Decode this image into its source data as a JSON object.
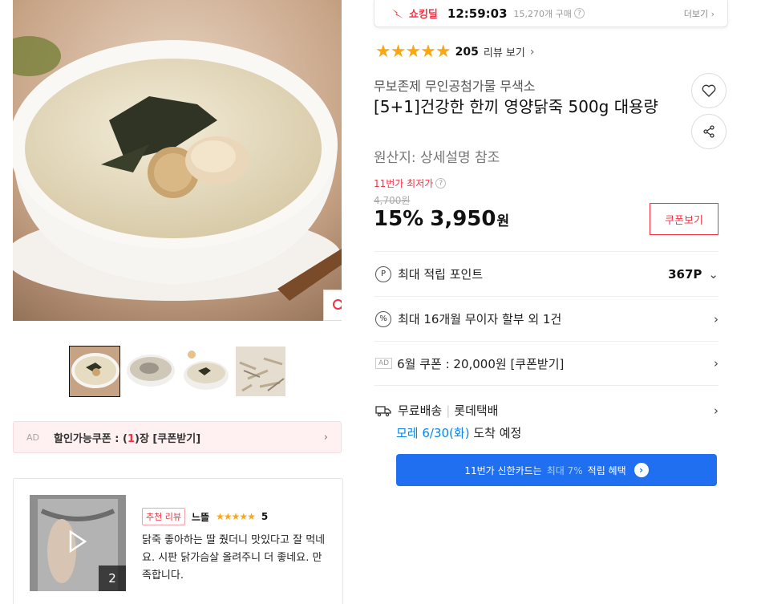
{
  "shocking_deal": {
    "logo": "쇼킹딜",
    "timer": "12:59:03",
    "sold": "15,270개 구매",
    "more": "더보기"
  },
  "rating": {
    "stars": "★★★★★",
    "count": "205",
    "link": "리뷰 보기"
  },
  "product": {
    "brand": "무보존제 무인공첨가물 무색소",
    "title": "[5+1]건강한 한끼 영양닭죽 500g 대용량",
    "origin": "원산지: 상세설명 참조",
    "lowest_label": "11번가 최저가",
    "original_price": "4,700원",
    "discount": "15%",
    "price": "3,950",
    "currency": "원",
    "coupon_button": "쿠폰보기"
  },
  "info_rows": {
    "points_label": "최대 적립 포인트",
    "points_value": "367P",
    "installment": "최대 16개월 무이자 할부 외 1건",
    "ad_tag": "AD",
    "coupon_ad": "6월 쿠폰 : 20,000원 [쿠폰받기]"
  },
  "shipping": {
    "free": "무료배송",
    "carrier": "롯데택배",
    "date": "모레 6/30(화)",
    "arrival": "도착 예정"
  },
  "card_banner": {
    "prefix": "11번가 신한카드는",
    "highlight": "최대 7%",
    "suffix": "적립 혜택"
  },
  "left_coupon": {
    "ad": "AD",
    "label": "할인가능쿠폰 : (",
    "count": "1",
    "suffix": ")장 [쿠폰받기]"
  },
  "review": {
    "badge": "추천 리뷰",
    "reviewer": "느뜰",
    "stars": "★★★★★",
    "score": "5",
    "body": "닭죽 좋아하는 딸 줬더니 맛있다고 잘 먹네요. 시판 닭가슴살 올려주니 더 좋네요. 만족합니다.",
    "media_count": "2"
  },
  "colors": {
    "accent_red": "#f43142",
    "star": "#f9a814",
    "banner_blue": "#1f6ff0",
    "ship_blue": "#0b83e6"
  }
}
